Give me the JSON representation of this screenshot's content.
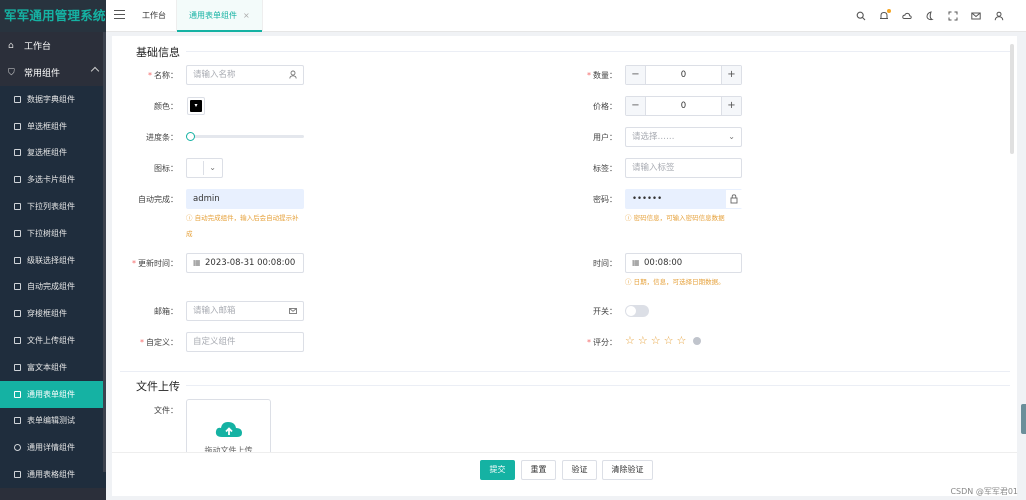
{
  "app": {
    "title": "军军通用管理系统"
  },
  "sidebar": {
    "top_item": "工作台",
    "group_label": "常用组件",
    "items": [
      {
        "label": "数据字典组件",
        "active": false
      },
      {
        "label": "单选框组件",
        "active": false
      },
      {
        "label": "复选框组件",
        "active": false
      },
      {
        "label": "多选卡片组件",
        "active": false
      },
      {
        "label": "下拉列表组件",
        "active": false
      },
      {
        "label": "下拉树组件",
        "active": false
      },
      {
        "label": "级联选择组件",
        "active": false
      },
      {
        "label": "自动完成组件",
        "active": false
      },
      {
        "label": "穿梭框组件",
        "active": false
      },
      {
        "label": "文件上传组件",
        "active": false
      },
      {
        "label": "富文本组件",
        "active": false
      },
      {
        "label": "通用表单组件",
        "active": true
      },
      {
        "label": "表单编辑测试",
        "active": false
      },
      {
        "label": "通用详情组件",
        "active": false
      },
      {
        "label": "通用表格组件",
        "active": false
      }
    ]
  },
  "tabs": [
    {
      "label": "工作台"
    },
    {
      "label": "通用表单组件",
      "close": "×"
    }
  ],
  "form": {
    "section_basic": "基础信息",
    "section_upload": "文件上传",
    "name": {
      "label": "名称：",
      "placeholder": "请输入名称"
    },
    "quantity": {
      "label": "数量：",
      "value": "0",
      "minus": "−",
      "plus": "+"
    },
    "color": {
      "label": "颜色：",
      "value": "#000000"
    },
    "price": {
      "label": "价格：",
      "value": "0",
      "minus": "−",
      "plus": "+"
    },
    "progress": {
      "label": "进度条：",
      "value": 0
    },
    "user": {
      "label": "用户：",
      "placeholder": "请选择……"
    },
    "icon": {
      "label": "图标："
    },
    "tags": {
      "label": "标签：",
      "placeholder": "请输入标签"
    },
    "autocomplete": {
      "label": "自动完成：",
      "value": "admin",
      "hint_line1": "ⓘ 自动完成组件，输入后会自动提示补",
      "hint_line2": "成"
    },
    "password": {
      "label": "密码：",
      "value": "••••••",
      "hint": "ⓘ 密码信息，可输入密码信息数据"
    },
    "update_time": {
      "label": "更新时间：",
      "value": "2023-08-31 00:08:00"
    },
    "time": {
      "label": "时间：",
      "value": "00:08:00",
      "hint": "ⓘ 日期，信息，可选择日期数据。"
    },
    "email": {
      "label": "邮箱：",
      "placeholder": "请输入邮箱"
    },
    "switch": {
      "label": "开关：",
      "on": false
    },
    "custom": {
      "label": "自定义：",
      "placeholder": "自定义组件"
    },
    "rating": {
      "label": "评分：",
      "value": 0,
      "max": 5
    },
    "file": {
      "label": "文件：",
      "upload_text": "拖动文件上传"
    }
  },
  "footer": {
    "submit": "提交",
    "reset": "重置",
    "validate": "验证",
    "clear_validate": "清除验证"
  },
  "watermark": "CSDN @军军君01",
  "colors": {
    "accent": "#15b2a3",
    "sidebar_bg": "#2b2f3a",
    "hint": "#e6a23c",
    "required": "#f56c6c"
  }
}
